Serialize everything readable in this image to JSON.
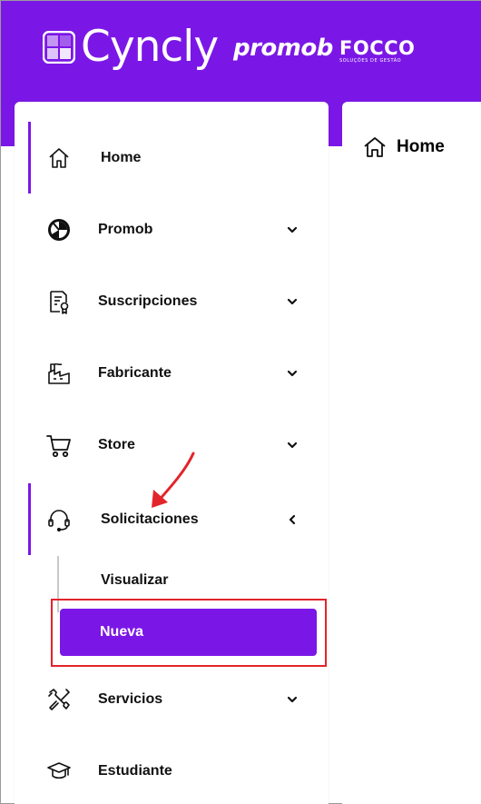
{
  "header": {
    "brand_name": "Cyncly",
    "partner1": "promob",
    "partner2": "FOCCO",
    "partner2_sub": "SOLUÇÕES DE GESTÃO",
    "background": "#7b17e6"
  },
  "sidebar": {
    "items": [
      {
        "label": "Home",
        "icon": "home-icon",
        "active": true,
        "chevron": null
      },
      {
        "label": "Promob",
        "icon": "promob-icon",
        "chevron": "down"
      },
      {
        "label": "Suscripciones",
        "icon": "certificate-icon",
        "chevron": "down"
      },
      {
        "label": "Fabricante",
        "icon": "factory-icon",
        "chevron": "down"
      },
      {
        "label": "Store",
        "icon": "cart-icon",
        "chevron": "down"
      },
      {
        "label": "Solicitaciones",
        "icon": "headset-icon",
        "active": true,
        "chevron": "left",
        "subitems": [
          {
            "label": "Visualizar"
          },
          {
            "label": "Nueva",
            "selected": true
          }
        ]
      },
      {
        "label": "Servicios",
        "icon": "tools-icon",
        "chevron": "down"
      },
      {
        "label": "Estudiante",
        "icon": "graduation-cap-icon",
        "chevron": null
      }
    ]
  },
  "main": {
    "title": "Home",
    "title_icon": "home-icon"
  },
  "colors": {
    "accent": "#7b17e6",
    "highlight": "#e3242b"
  }
}
